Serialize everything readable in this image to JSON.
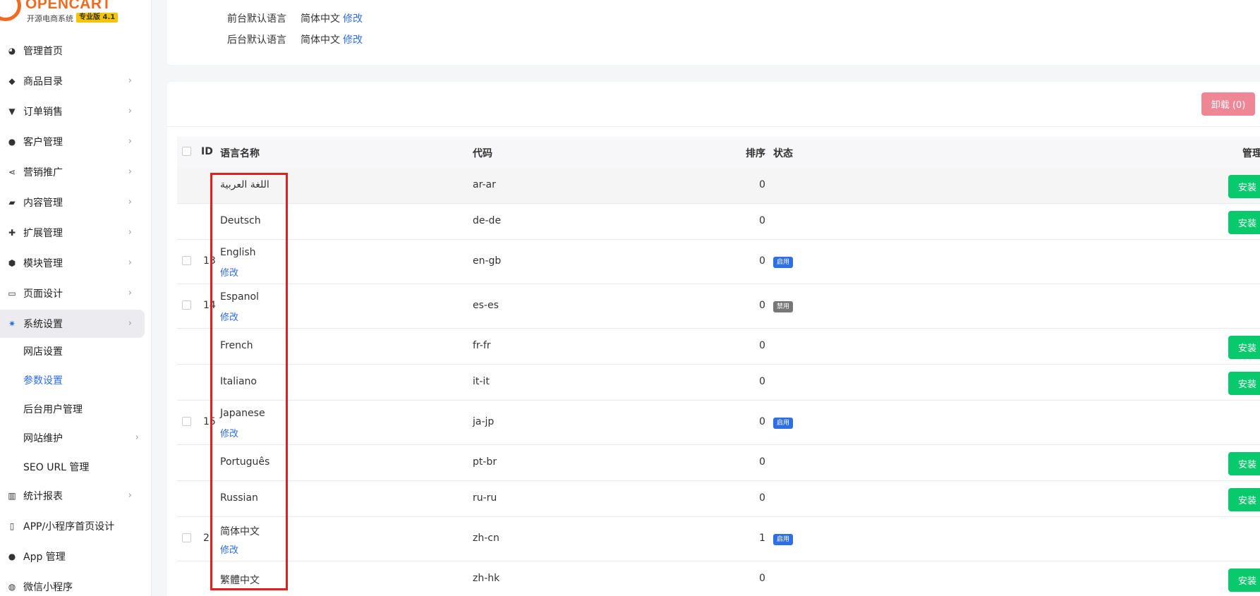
{
  "brand": {
    "name": "OPENCART",
    "subtitle": "开源电商系统",
    "edition": "专业版 4.1"
  },
  "sidebar": {
    "items": [
      {
        "label": "管理首页",
        "icon": "dashboard-icon",
        "glyph": "◕",
        "has_children": false
      },
      {
        "label": "商品目录",
        "icon": "tags-icon",
        "glyph": "◆",
        "has_children": true
      },
      {
        "label": "订单销售",
        "icon": "cart-icon",
        "glyph": "▼",
        "has_children": true
      },
      {
        "label": "客户管理",
        "icon": "user-icon",
        "glyph": "●",
        "has_children": true
      },
      {
        "label": "营销推广",
        "icon": "share-icon",
        "glyph": "⋖",
        "has_children": true
      },
      {
        "label": "内容管理",
        "icon": "book-icon",
        "glyph": "▰",
        "has_children": true
      },
      {
        "label": "扩展管理",
        "icon": "puzzle-icon",
        "glyph": "✚",
        "has_children": true
      },
      {
        "label": "模块管理",
        "icon": "cube-icon",
        "glyph": "⬢",
        "has_children": true
      },
      {
        "label": "页面设计",
        "icon": "desktop-icon",
        "glyph": "▭",
        "has_children": true
      },
      {
        "label": "系统设置",
        "icon": "gear-icon",
        "glyph": "✷",
        "has_children": true,
        "active": true
      }
    ],
    "sub_items": [
      {
        "label": "网店设置"
      },
      {
        "label": "参数设置",
        "current": true
      },
      {
        "label": "后台用户管理"
      },
      {
        "label": "网站维护",
        "has_children": true
      },
      {
        "label": "SEO URL 管理"
      }
    ],
    "bottom_items": [
      {
        "label": "统计报表",
        "icon": "bar-chart-icon",
        "glyph": "▥",
        "has_children": true
      },
      {
        "label": "APP/小程序首页设计",
        "icon": "mobile-icon",
        "glyph": "▯",
        "has_children": false
      },
      {
        "label": "App 管理",
        "icon": "apple-icon",
        "glyph": "●",
        "has_children": false
      },
      {
        "label": "微信小程序",
        "icon": "wechat-icon",
        "glyph": "◍",
        "has_children": false
      }
    ]
  },
  "defaults": {
    "front_label": "前台默认语言",
    "front_value": "简体中文",
    "front_edit": "修改",
    "admin_label": "后台默认语言",
    "admin_value": "简体中文",
    "admin_edit": "修改"
  },
  "toolbar": {
    "uninstall_label": "卸载 (0)"
  },
  "table": {
    "headers": {
      "id": "ID",
      "name": "语言名称",
      "code": "代码",
      "sort": "排序",
      "status": "状态",
      "manage": "管理"
    },
    "install_label": "安装",
    "rows": [
      {
        "id": "",
        "name": "اللغة العربية",
        "code": "ar-ar",
        "sort": "0",
        "status": "",
        "edit": "",
        "installed": false
      },
      {
        "id": "",
        "name": "Deutsch",
        "code": "de-de",
        "sort": "0",
        "status": "",
        "edit": "",
        "installed": false
      },
      {
        "id": "13",
        "name": "English",
        "code": "en-gb",
        "sort": "0",
        "status": "启用",
        "edit": "修改",
        "installed": true
      },
      {
        "id": "14",
        "name": "Espanol",
        "code": "es-es",
        "sort": "0",
        "status": "禁用",
        "edit": "修改",
        "installed": true
      },
      {
        "id": "",
        "name": "French",
        "code": "fr-fr",
        "sort": "0",
        "status": "",
        "edit": "",
        "installed": false
      },
      {
        "id": "",
        "name": "Italiano",
        "code": "it-it",
        "sort": "0",
        "status": "",
        "edit": "",
        "installed": false
      },
      {
        "id": "15",
        "name": "Japanese",
        "code": "ja-jp",
        "sort": "0",
        "status": "启用",
        "edit": "修改",
        "installed": true
      },
      {
        "id": "",
        "name": "Português",
        "code": "pt-br",
        "sort": "0",
        "status": "",
        "edit": "",
        "installed": false
      },
      {
        "id": "",
        "name": "Russian",
        "code": "ru-ru",
        "sort": "0",
        "status": "",
        "edit": "",
        "installed": false
      },
      {
        "id": "2",
        "name": "简体中文",
        "code": "zh-cn",
        "sort": "1",
        "status": "启用",
        "edit": "修改",
        "installed": true
      },
      {
        "id": "",
        "name": "繁體中文",
        "code": "zh-hk",
        "sort": "0",
        "status": "",
        "edit": "",
        "installed": false
      }
    ]
  },
  "colors": {
    "accent": "#2f6fe4",
    "install": "#08c96b",
    "uninstall": "#ee8695",
    "enabled": "#2f6fe4",
    "disabled": "#777777",
    "highlight_box": "#e02020",
    "brand": "#f06a22"
  }
}
